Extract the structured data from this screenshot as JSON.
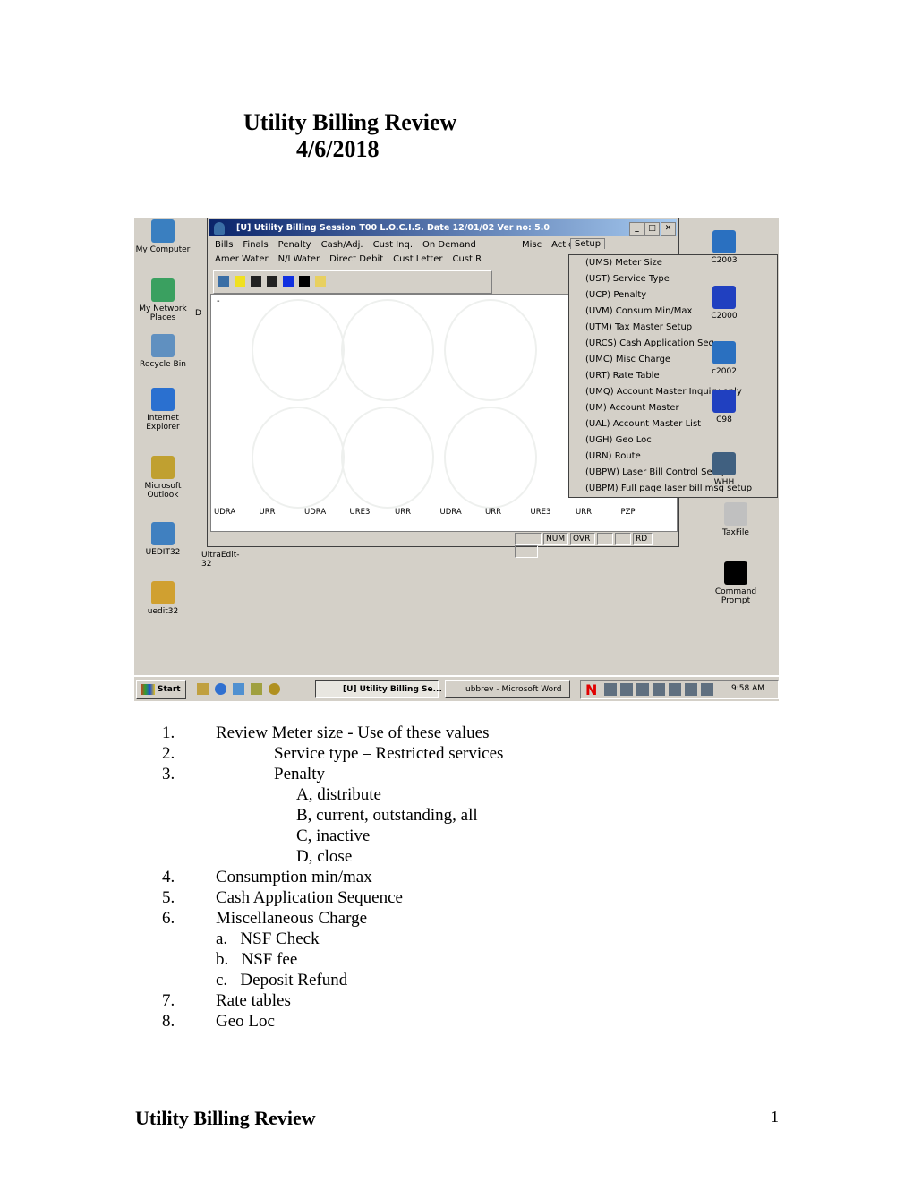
{
  "heading": {
    "title": "Utility Billing Review",
    "date": "4/6/2018"
  },
  "screenshot": {
    "desktop_left": [
      "My Computer",
      "My Network Places",
      "Recycle Bin",
      "Internet Explorer",
      "Microsoft Outlook",
      "UEDIT32",
      "uedit32"
    ],
    "desktop_partial": [
      "D",
      "UltraEdit-32"
    ],
    "desktop_right": [
      "C2003",
      "C2000",
      "c2002",
      "C98",
      "WHH",
      "TaxFile",
      "Command Prompt"
    ],
    "window": {
      "title": "[U] Utility Billing  Session  T00   L.O.C.I.S.     Date 12/01/02  Ver no: 5.0",
      "menu_row1": [
        "Bills",
        "Finals",
        "Penalty",
        "Cash/Adj.",
        "Cust Inq.",
        "On Demand",
        "Setup",
        "Misc",
        "Action"
      ],
      "menu_row2": [
        "Amer Water",
        "N/I Water",
        "Direct Debit",
        "Cust Letter",
        "Cust R"
      ],
      "codes": [
        "UDRA",
        "URR",
        "UDRA",
        "URE3",
        "URR",
        "UDRA",
        "URR",
        "URE3",
        "URR",
        "PZP"
      ],
      "status": [
        "",
        "NUM",
        "OVR",
        "",
        "",
        "RD",
        ""
      ]
    },
    "setup_menu": [
      "(UMS) Meter Size",
      "(UST) Service Type",
      "(UCP) Penalty",
      "(UVM) Consum Min/Max",
      "(UTM) Tax Master Setup",
      "(URCS) Cash Application Seq.",
      "(UMC) Misc Charge",
      "(URT) Rate Table",
      "(UMQ) Account Master Inquiry only",
      "(UM) Account Master",
      "(UAL) Account Master List",
      "(UGH) Geo Loc",
      "(URN) Route",
      "(UBPW) Laser Bill Control Setup",
      "(UBPM) Full page laser bill msg setup"
    ],
    "taskbar": {
      "start": "Start",
      "task1": "[U] Utility Billing  Se...",
      "task2": "ubbrev - Microsoft Word",
      "clock": "9:58 AM"
    }
  },
  "list": [
    {
      "num": "1.",
      "text": "Review Meter size - Use of these values",
      "indent": 0
    },
    {
      "num": "2.",
      "text": "Service type – Restricted services",
      "indent": 1
    },
    {
      "num": "3.",
      "text": "Penalty",
      "indent": 1
    },
    {
      "num": "",
      "text": "A, distribute",
      "indent": 2
    },
    {
      "num": "",
      "text": "B, current, outstanding, all",
      "indent": 2
    },
    {
      "num": "",
      "text": "C, inactive",
      "indent": 2
    },
    {
      "num": "",
      "text": "D, close",
      "indent": 2
    },
    {
      "num": "4.",
      "text": "Consumption min/max",
      "indent": 0
    },
    {
      "num": "5.",
      "text": "Cash Application Sequence",
      "indent": 0
    },
    {
      "num": "6.",
      "text": "Miscellaneous Charge",
      "indent": 0
    },
    {
      "num": "",
      "text": "a.   NSF Check",
      "indent": 0
    },
    {
      "num": "",
      "text": "b.   NSF fee",
      "indent": 0
    },
    {
      "num": "",
      "text": "c.   Deposit Refund",
      "indent": 0
    },
    {
      "num": "7.",
      "text": "Rate tables",
      "indent": 0
    },
    {
      "num": "8.",
      "text": "Geo Loc",
      "indent": 0
    }
  ],
  "footer": {
    "title": "Utility Billing Review",
    "page": "1"
  }
}
